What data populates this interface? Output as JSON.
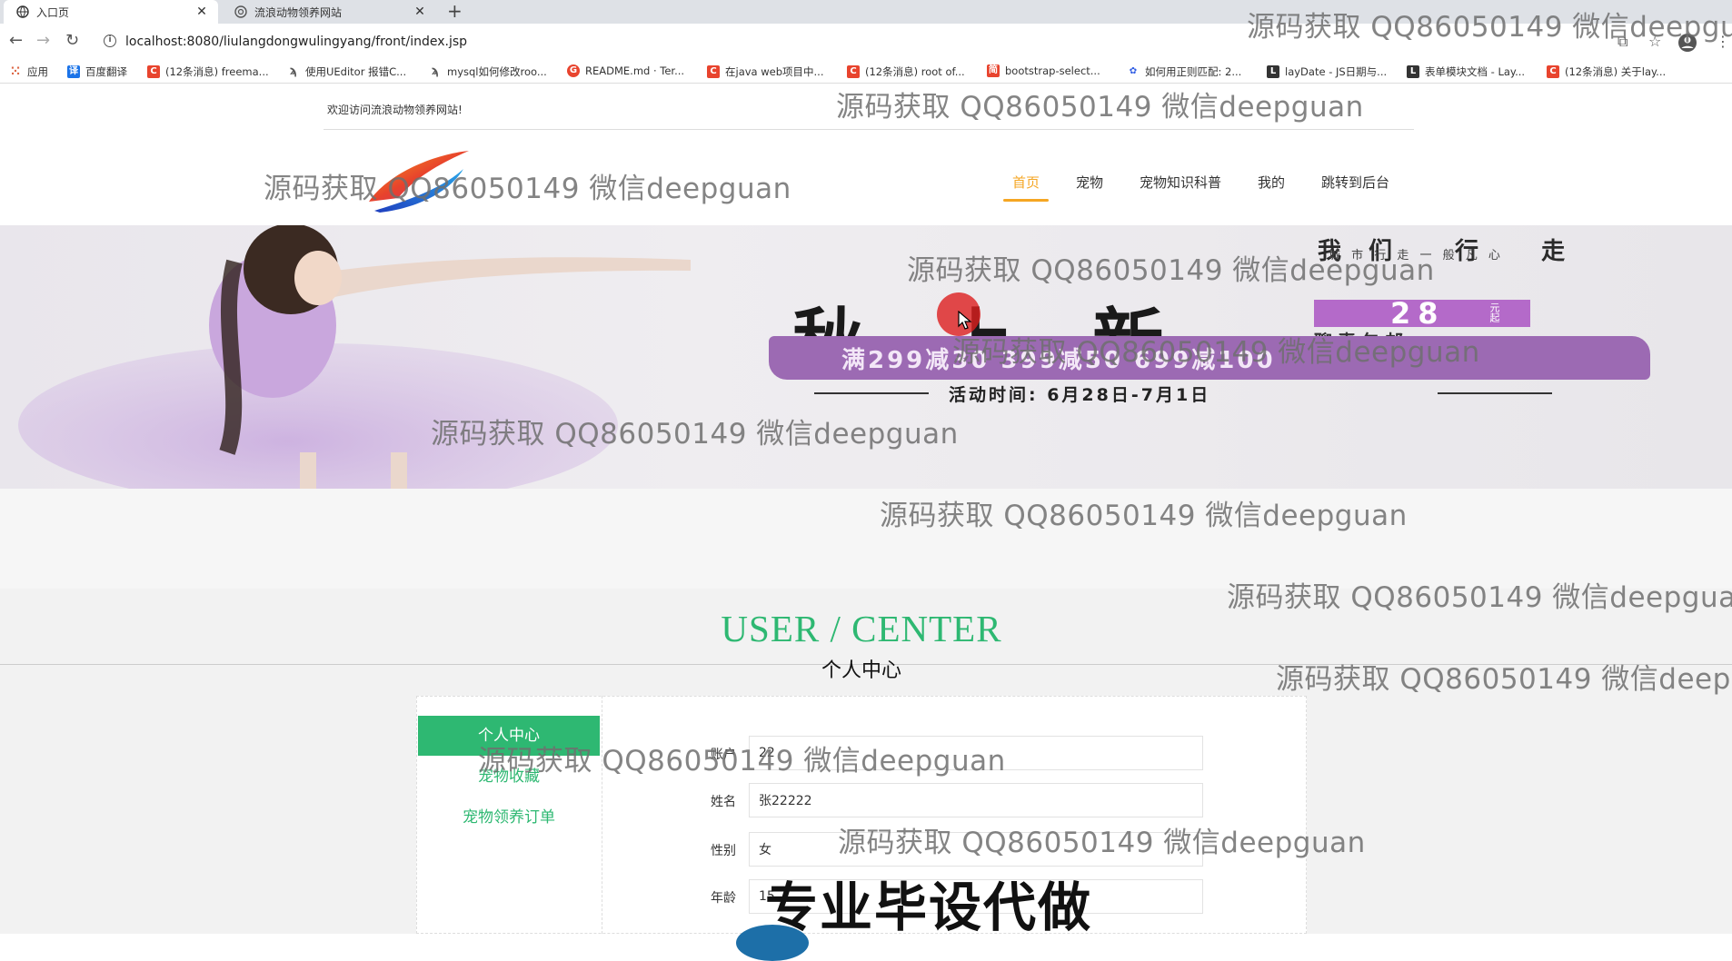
{
  "browser": {
    "tabs": [
      {
        "title": "入口页",
        "active": true
      },
      {
        "title": "流浪动物领养网站",
        "active": false
      }
    ],
    "url": "localhost:8080/liulangdongwulingyang/front/index.jsp",
    "bookmarks": [
      "应用",
      "百度翻译",
      "(12条消息) freema...",
      "使用UEditor 报错C...",
      "mysql如何修改roo...",
      "README.md · Ter...",
      "在java web项目中...",
      "(12条消息) root of...",
      "bootstrap-select...",
      "如何用正则匹配: 2...",
      "layDate - JS日期与...",
      "表单模块文档 - Lay...",
      "(12条消息) 关于lay..."
    ]
  },
  "header": {
    "welcome": "欢迎访问流浪动物领养网站!",
    "nav": [
      "首页",
      "宠物",
      "宠物知识科普",
      "我的",
      "跳转到后台"
    ]
  },
  "banner": {
    "top_text": "我们 行 走",
    "top_sub": "城 市 行 走      一 般 凡 心",
    "headline": "秋 上 新",
    "price": "28",
    "price_unit": "元起",
    "shipping": "聊素包邮",
    "discount": "满299减30  399减50  699减100",
    "period": "活动时间: 6月28日-7月1日"
  },
  "section": {
    "title": "USER / CENTER",
    "subtitle": "个人中心"
  },
  "sidebar": [
    "个人中心",
    "宠物收藏",
    "宠物领养订单"
  ],
  "form": {
    "fields": [
      {
        "label": "账户",
        "value": "22"
      },
      {
        "label": "姓名",
        "value": "张22222"
      },
      {
        "label": "性别",
        "value": "女"
      },
      {
        "label": "年龄",
        "value": "15"
      }
    ]
  },
  "overlays": {
    "watermark": "源码获取 QQ86050149 微信deepguan",
    "promo": "专业毕设代做"
  },
  "colors": {
    "accent_green": "#2eb872",
    "nav_active": "#f5a623"
  }
}
